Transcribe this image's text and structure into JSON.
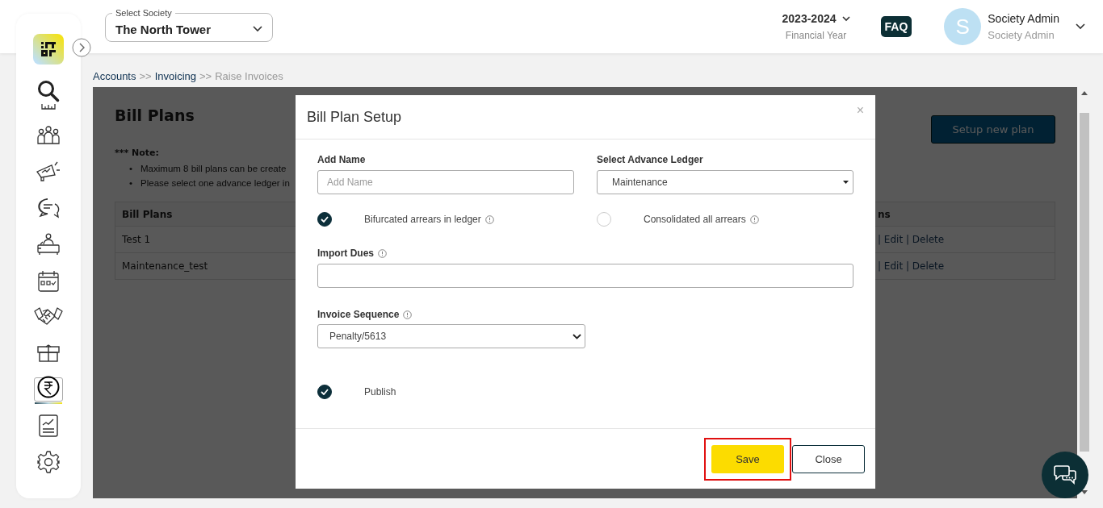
{
  "header": {
    "society_select": {
      "label": "Select Society",
      "value": "The North Tower"
    },
    "financial_year": {
      "value": "2023-2024",
      "label": "Financial Year"
    },
    "faq": "FAQ",
    "user": {
      "initial": "S",
      "name": "Society Admin",
      "role": "Society Admin"
    }
  },
  "sidebar": {
    "items": [
      {
        "selected": false
      },
      {
        "selected": false
      },
      {
        "selected": false
      },
      {
        "selected": false
      },
      {
        "selected": false
      },
      {
        "selected": false
      },
      {
        "selected": false
      },
      {
        "selected": false
      },
      {
        "selected": false
      },
      {
        "selected": true
      },
      {
        "selected": false
      },
      {
        "selected": false
      }
    ]
  },
  "breadcrumb": [
    {
      "label": "Accounts",
      "kind": "link"
    },
    {
      "label": ">>",
      "kind": "separator"
    },
    {
      "label": "Invoicing",
      "kind": "link"
    },
    {
      "label": ">>",
      "kind": "separator"
    },
    {
      "label": "Raise Invoices",
      "kind": "current"
    }
  ],
  "page": {
    "title": "Bill Plans",
    "setup_button": "Setup new plan",
    "note": {
      "heading": "*** Note:",
      "marker": "•",
      "bullets": [
        "Maximum 8 bill plans can be create",
        "Please select one advance ledger in"
      ]
    },
    "table": {
      "columns": [
        "Bill Plans",
        "ns"
      ],
      "rows": [
        {
          "cells": [
            "Test 1",
            "| Edit | Delete"
          ]
        },
        {
          "cells": [
            "Maintenance_test",
            "| Edit | Delete"
          ]
        }
      ]
    }
  },
  "modal": {
    "title": "Bill Plan Setup",
    "close": "×",
    "name_field": {
      "label": "Add Name",
      "placeholder": "Add Name"
    },
    "ledger_select": {
      "label": "Select Advance Ledger",
      "value": "Maintenance"
    },
    "arrears_options": [
      {
        "label": "Bifurcated arrears in ledger",
        "selected": true
      },
      {
        "label": "Consolidated all arrears",
        "selected": false
      }
    ],
    "import_dues": {
      "label": "Import Dues"
    },
    "invoice_sequence": {
      "label": "Invoice Sequence",
      "value": "Penalty/5613"
    },
    "publish": {
      "label": "Publish",
      "checked": true
    },
    "buttons": [
      {
        "label": "Save",
        "kind": "primary",
        "highlighted": true
      },
      {
        "label": "Close",
        "kind": "secondary",
        "highlighted": false
      }
    ]
  }
}
